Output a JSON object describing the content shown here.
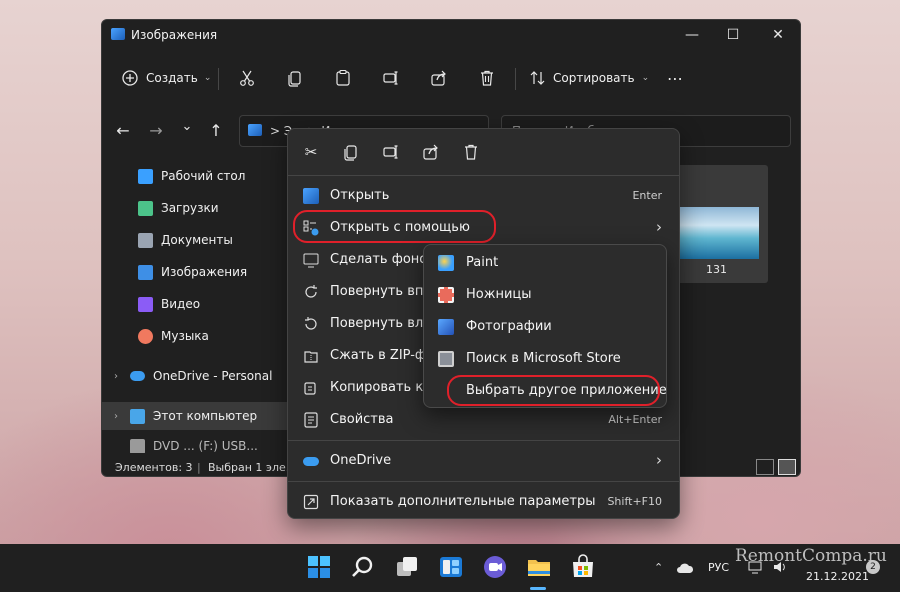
{
  "window": {
    "title": "Изображения",
    "controls": {
      "minimize": "—",
      "maximize": "☐",
      "close": "✕"
    }
  },
  "toolbar": {
    "create_label": "Создать",
    "sort_label": "Сортировать",
    "more_label": "⋯"
  },
  "nav": {
    "back": "←",
    "forward": "→",
    "recent": "⌄",
    "up": "↑",
    "address_text": "> Э... > И...",
    "search_placeholder": "Поиск в Изоб..."
  },
  "sidebar": {
    "items": [
      {
        "label": "Рабочий стол",
        "icon": "desktop-icon",
        "color": "#3aa0ff"
      },
      {
        "label": "Загрузки",
        "icon": "download-icon",
        "color": "#4cc38a"
      },
      {
        "label": "Документы",
        "icon": "document-icon",
        "color": "#9aa4b2"
      },
      {
        "label": "Изображения",
        "icon": "image-icon",
        "color": "#3e8fe6"
      },
      {
        "label": "Видео",
        "icon": "video-icon",
        "color": "#8b5cf6"
      },
      {
        "label": "Музыка",
        "icon": "music-icon",
        "color": "#f0795f"
      },
      {
        "label": "OneDrive - Personal",
        "icon": "onedrive-icon",
        "color": "#3b9cf0"
      },
      {
        "label": "Этот компьютер",
        "icon": "computer-icon",
        "color": "#49a6e9"
      },
      {
        "label": "DVD ... (F:) USB...",
        "icon": "dvd-icon",
        "color": "#9a9a9a"
      }
    ]
  },
  "content": {
    "items": [
      {
        "name": "131",
        "selected": true
      }
    ]
  },
  "status": {
    "items_count": "Элементов: 3",
    "selected": "Выбран 1 эле..."
  },
  "context_menu": {
    "items": [
      {
        "label": "Открыть",
        "shortcut": "Enter",
        "icon": "image-icon"
      },
      {
        "label": "Открыть с помощью",
        "shortcut": "›",
        "icon": "open-with-icon",
        "highlighted": true
      },
      {
        "label": "Сделать фоновым...",
        "shortcut": "",
        "icon": "wallpaper-icon"
      },
      {
        "label": "Повернуть впр...",
        "shortcut": "",
        "icon": "rotate-right-icon"
      },
      {
        "label": "Повернуть вле...",
        "shortcut": "",
        "icon": "rotate-left-icon"
      },
      {
        "label": "Сжать в ZIP-фа...",
        "shortcut": "",
        "icon": "zip-icon"
      },
      {
        "label": "Копировать ка...",
        "shortcut": "",
        "icon": "copy-path-icon"
      },
      {
        "label": "Свойства",
        "shortcut": "Alt+Enter",
        "icon": "properties-icon"
      },
      {
        "label": "OneDrive",
        "shortcut": "›",
        "icon": "onedrive-icon"
      },
      {
        "label": "Показать дополнительные параметры",
        "shortcut": "Shift+F10",
        "icon": "more-options-icon"
      }
    ],
    "quick_actions": [
      "cut-icon",
      "copy-icon",
      "rename-icon",
      "share-icon",
      "delete-icon"
    ]
  },
  "open_with_submenu": {
    "items": [
      {
        "label": "Paint",
        "icon": "paint-icon",
        "color": "#3aa0ff"
      },
      {
        "label": "Ножницы",
        "icon": "snipping-icon",
        "color": "#e96b5c"
      },
      {
        "label": "Фотографии",
        "icon": "photos-icon",
        "color": "#3e7fe0"
      },
      {
        "label": "Поиск в Microsoft Store",
        "icon": "store-icon",
        "color": "#8a8f98"
      },
      {
        "label": "Выбрать другое приложение",
        "icon": "",
        "highlighted": true
      }
    ]
  },
  "taskbar": {
    "icons": [
      "start-icon",
      "search-icon",
      "task-view-icon",
      "widgets-icon",
      "chat-icon",
      "explorer-icon",
      "store-icon"
    ],
    "language": "РУС",
    "date": "21.12.2021",
    "notification_count": "2"
  },
  "watermark": "RemontCompa.ru",
  "colors": {
    "accent": "#58b6ff",
    "highlight_ring": "#e0202a"
  }
}
